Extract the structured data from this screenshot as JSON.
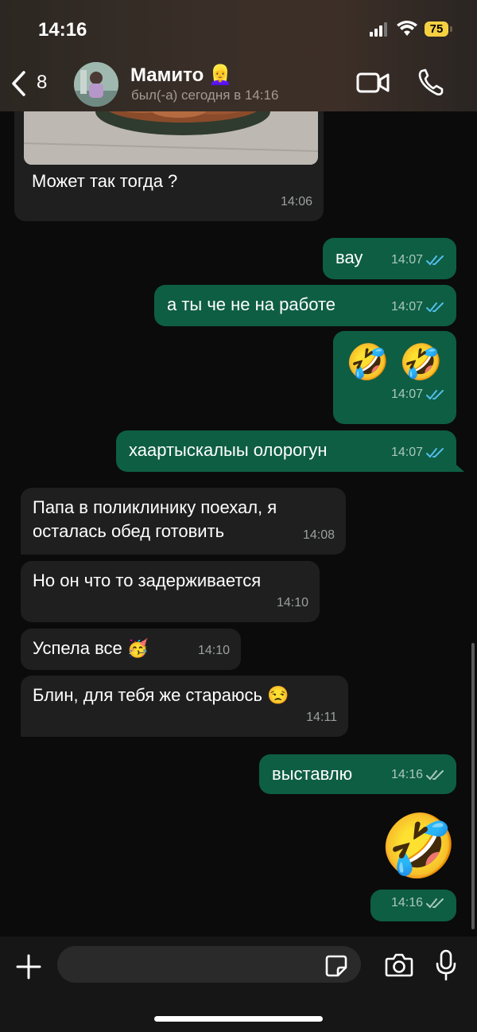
{
  "status_bar": {
    "time": "14:16",
    "battery": "75"
  },
  "header": {
    "back_count": "8",
    "contact_name": "Мамито",
    "contact_emoji": "👱‍♀️",
    "last_seen": "был(-а) сегодня в 14:16"
  },
  "messages": [
    {
      "dir": "in",
      "text": "Может так тогда ?",
      "time": "14:06",
      "has_photo": true
    },
    {
      "dir": "out",
      "text": "вау",
      "time": "14:07",
      "status": "read"
    },
    {
      "dir": "out",
      "text": "а ты че не на работе",
      "time": "14:07",
      "status": "read"
    },
    {
      "dir": "out",
      "text": "🤣 🤣",
      "time": "14:07",
      "status": "read"
    },
    {
      "dir": "out",
      "text": "хаартыскалыы олорогун",
      "time": "14:07",
      "status": "read"
    },
    {
      "dir": "in",
      "text": "Папа в поликлинику поехал,  я осталась обед готовить",
      "time": "14:08"
    },
    {
      "dir": "in",
      "text": "Но он что то задерживается",
      "time": "14:10"
    },
    {
      "dir": "in",
      "text": "Успела все 🥳",
      "time": "14:10"
    },
    {
      "dir": "in",
      "text": "Блин, для тебя же стараюсь 😒",
      "time": "14:11"
    },
    {
      "dir": "out",
      "text": "выставлю",
      "time": "14:16",
      "status": "delivered"
    },
    {
      "dir": "out",
      "text": "🤣",
      "time": "14:16",
      "status": "delivered"
    }
  ],
  "input": {
    "placeholder": "",
    "value": ""
  },
  "icons": {
    "back": "chevron-left-icon",
    "video": "video-camera-icon",
    "call": "phone-icon",
    "plus": "plus-icon",
    "sticker": "sticker-icon",
    "camera": "camera-icon",
    "mic": "microphone-icon"
  },
  "colors": {
    "incoming_bubble": "#1f1f1f",
    "outgoing_bubble": "#0e5e44",
    "read_ticks": "#53bdeb",
    "delivered_ticks": "#a9c8bc"
  }
}
